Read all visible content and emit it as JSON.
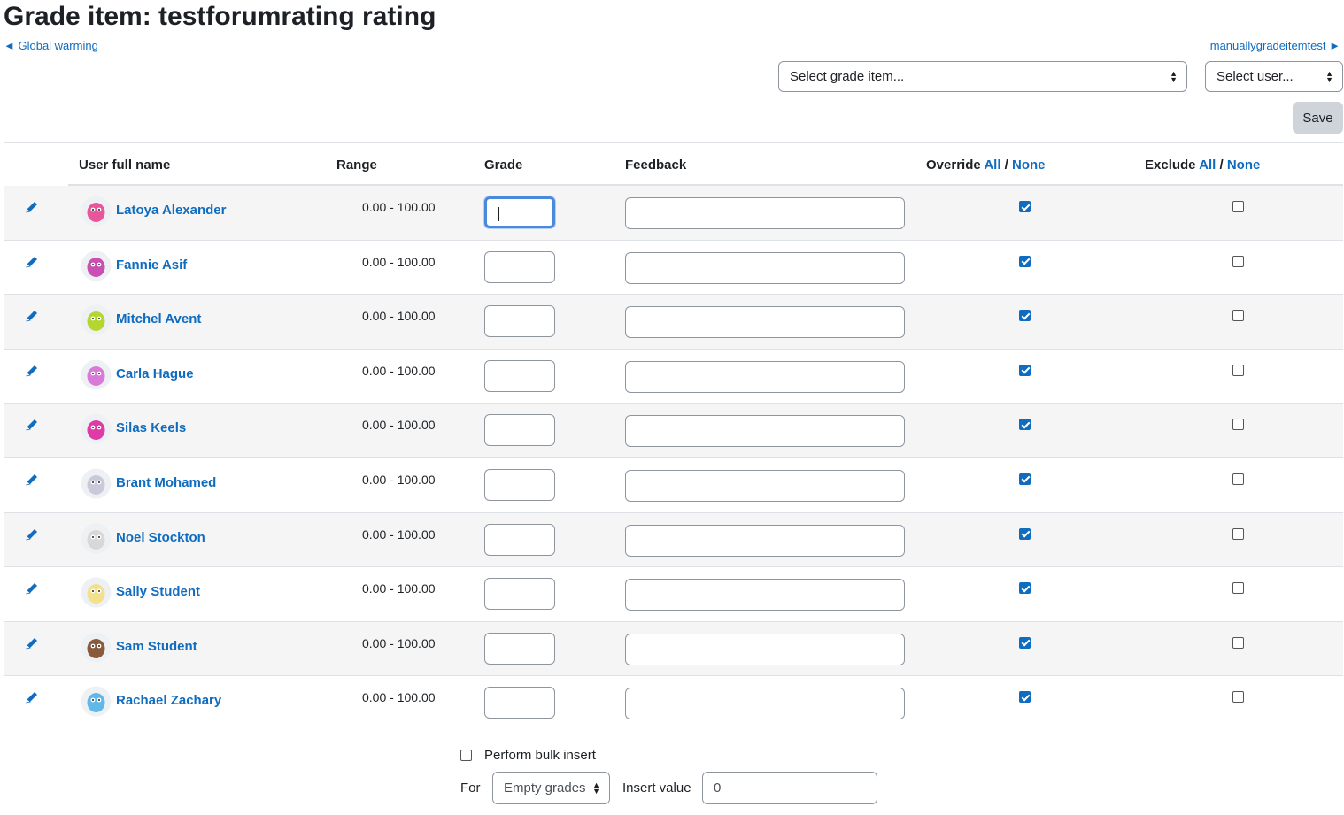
{
  "page": {
    "title": "Grade item: testforumrating rating"
  },
  "nav": {
    "prev": "◄ Global warming",
    "next": "manuallygradeitemtest ►"
  },
  "selectors": {
    "grade_item": "Select grade item...",
    "user": "Select user..."
  },
  "actions": {
    "save": "Save"
  },
  "table": {
    "headers": {
      "user": "User full name",
      "range": "Range",
      "grade": "Grade",
      "feedback": "Feedback",
      "override": "Override",
      "exclude": "Exclude",
      "all": "All",
      "none": "None",
      "sep": "/"
    },
    "rows": [
      {
        "name": "Latoya Alexander",
        "range": "0.00 - 100.00",
        "grade": "",
        "feedback": "",
        "override": true,
        "exclude": false,
        "avatar_color": "#e8559a"
      },
      {
        "name": "Fannie Asif",
        "range": "0.00 - 100.00",
        "grade": "",
        "feedback": "",
        "override": true,
        "exclude": false,
        "avatar_color": "#c94fb3"
      },
      {
        "name": "Mitchel Avent",
        "range": "0.00 - 100.00",
        "grade": "",
        "feedback": "",
        "override": true,
        "exclude": false,
        "avatar_color": "#b4d62f"
      },
      {
        "name": "Carla Hague",
        "range": "0.00 - 100.00",
        "grade": "",
        "feedback": "",
        "override": true,
        "exclude": false,
        "avatar_color": "#d97ad9"
      },
      {
        "name": "Silas Keels",
        "range": "0.00 - 100.00",
        "grade": "",
        "feedback": "",
        "override": true,
        "exclude": false,
        "avatar_color": "#e03aa8"
      },
      {
        "name": "Brant Mohamed",
        "range": "0.00 - 100.00",
        "grade": "",
        "feedback": "",
        "override": true,
        "exclude": false,
        "avatar_color": "#c9c9d9"
      },
      {
        "name": "Noel Stockton",
        "range": "0.00 - 100.00",
        "grade": "",
        "feedback": "",
        "override": true,
        "exclude": false,
        "avatar_color": "#d8d8d8"
      },
      {
        "name": "Sally Student",
        "range": "0.00 - 100.00",
        "grade": "",
        "feedback": "",
        "override": true,
        "exclude": false,
        "avatar_color": "#f3e08a"
      },
      {
        "name": "Sam Student",
        "range": "0.00 - 100.00",
        "grade": "",
        "feedback": "",
        "override": true,
        "exclude": false,
        "avatar_color": "#8a5a3a"
      },
      {
        "name": "Rachael Zachary",
        "range": "0.00 - 100.00",
        "grade": "",
        "feedback": "",
        "override": true,
        "exclude": false,
        "avatar_color": "#5fb8e8"
      }
    ]
  },
  "bulk": {
    "checkbox_label": "Perform bulk insert",
    "for_label": "For",
    "for_value": "Empty grades",
    "insert_label": "Insert value",
    "insert_value": "0"
  },
  "colors": {
    "link": "#0f6cbf",
    "stripe": "#f5f5f5",
    "focus": "#4a89dc"
  }
}
